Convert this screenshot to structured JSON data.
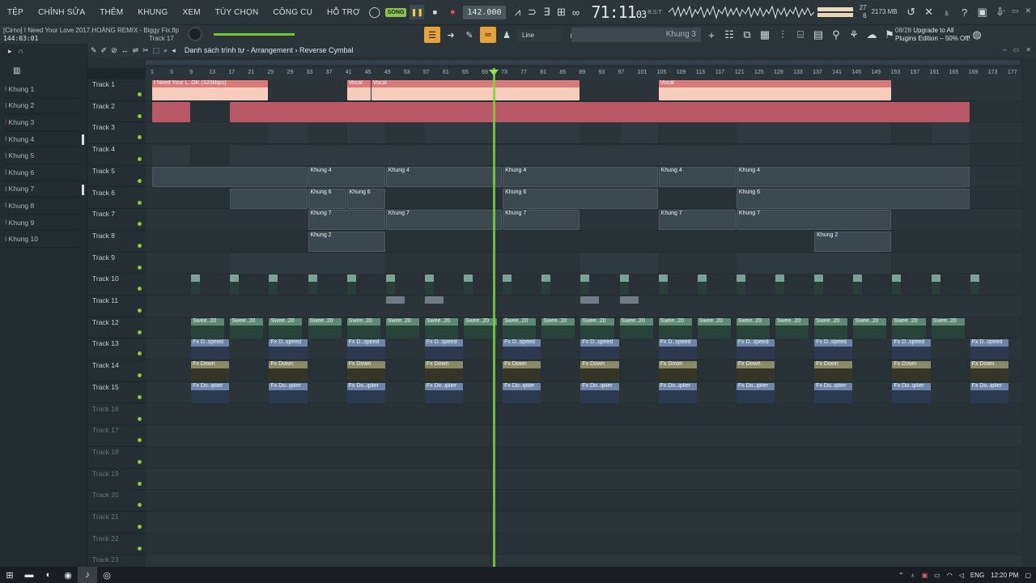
{
  "menu": [
    "TỆP",
    "CHỈNH SỬA",
    "THÊM",
    "KHUNG",
    "XEM",
    "TÙY CHỌN",
    "CÔNG CỤ",
    "HỖ TRỢ"
  ],
  "transport": {
    "song_label": "SONG",
    "tempo": "142.000",
    "clock": "71:11",
    "clock_ticks": "03",
    "clock_sub": "B:S:T"
  },
  "monitor": {
    "cpu_top": "27",
    "mem": "2173 MB",
    "poly": "6"
  },
  "file_title": "[Cirno] I Need Your Love 2017.HOÀNG REMIX - Biggy Fix.flp",
  "position": "144:03:01",
  "hint_track": "Track 17",
  "snap_label": "Line",
  "pattern_name": "Khung 3",
  "promo": {
    "line1": "08/28",
    "line1b": "Upgrade to All",
    "line2": "Plugins Edition – 50% Off!"
  },
  "channels": [
    {
      "label": "Khung 1",
      "active": false,
      "marked": false
    },
    {
      "label": "Khung 2",
      "active": false,
      "marked": false
    },
    {
      "label": "Khung 3",
      "active": true,
      "marked": false
    },
    {
      "label": "Khung 4",
      "active": false,
      "marked": true
    },
    {
      "label": "Khung 5",
      "active": false,
      "marked": false
    },
    {
      "label": "Khung 6",
      "active": false,
      "marked": false
    },
    {
      "label": "Khung 7",
      "active": false,
      "marked": true
    },
    {
      "label": "Khung 8",
      "active": false,
      "marked": false
    },
    {
      "label": "Khung 9",
      "active": false,
      "marked": false
    },
    {
      "label": "Khung 10",
      "active": false,
      "marked": false
    }
  ],
  "playlist": {
    "title": "Danh sách trình tự",
    "crumb1": "Arrangement",
    "crumb2": "Reverse Cymbal"
  },
  "ruler": [
    "1",
    "5",
    "9",
    "13",
    "17",
    "21",
    "25",
    "29",
    "33",
    "37",
    "41",
    "45",
    "49",
    "53",
    "57",
    "61",
    "65",
    "69",
    "73",
    "77",
    "81",
    "85",
    "89",
    "93",
    "97",
    "101",
    "105",
    "109",
    "113",
    "117",
    "121",
    "125",
    "129",
    "133",
    "137",
    "141",
    "145",
    "149",
    "153",
    "157",
    "161",
    "165",
    "169",
    "173",
    "177"
  ],
  "tracks": [
    {
      "label": "Track 1",
      "empty": false,
      "marked": true
    },
    {
      "label": "Track 2",
      "empty": false,
      "marked": false
    },
    {
      "label": "Track 3",
      "empty": false,
      "marked": true
    },
    {
      "label": "Track 4",
      "empty": false,
      "marked": false
    },
    {
      "label": "Track 5",
      "empty": false,
      "marked": true
    },
    {
      "label": "Track 6",
      "empty": false,
      "marked": false
    },
    {
      "label": "Track 7",
      "empty": false,
      "marked": true
    },
    {
      "label": "Track 8",
      "empty": false,
      "marked": false
    },
    {
      "label": "Track 9",
      "empty": false,
      "marked": false
    },
    {
      "label": "Track 10",
      "empty": false,
      "marked": false
    },
    {
      "label": "Track 11",
      "empty": false,
      "marked": false
    },
    {
      "label": "Track 12",
      "empty": false,
      "marked": true
    },
    {
      "label": "Track 13",
      "empty": false,
      "marked": false
    },
    {
      "label": "Track 14",
      "empty": false,
      "marked": false
    },
    {
      "label": "Track 15",
      "empty": false,
      "marked": false
    },
    {
      "label": "Track 16",
      "empty": true,
      "marked": false
    },
    {
      "label": "Track 17",
      "empty": true,
      "marked": false
    },
    {
      "label": "Track 18",
      "empty": true,
      "marked": false
    },
    {
      "label": "Track 19",
      "empty": true,
      "marked": false
    },
    {
      "label": "Track 20",
      "empty": true,
      "marked": false
    },
    {
      "label": "Track 21",
      "empty": true,
      "marked": false
    },
    {
      "label": "Track 22",
      "empty": true,
      "marked": false
    },
    {
      "label": "Track 23",
      "empty": true,
      "marked": false
    }
  ],
  "clips": [
    {
      "track": 0,
      "start": 1,
      "len": 24,
      "type": "audio-pink",
      "label": "I Need Your L..OK (320kbps)"
    },
    {
      "track": 0,
      "start": 41,
      "len": 5,
      "type": "audio-pink",
      "label": "Vocal"
    },
    {
      "track": 0,
      "start": 46,
      "len": 43,
      "type": "audio-pink",
      "label": "Vocal"
    },
    {
      "track": 0,
      "start": 105,
      "len": 48,
      "type": "audio-pink",
      "label": "Vocal"
    },
    {
      "track": 1,
      "start": 1,
      "len": 8,
      "type": "audio-red",
      "label": ""
    },
    {
      "track": 1,
      "start": 17,
      "len": 152,
      "type": "audio-red",
      "label": ""
    },
    {
      "track": 2,
      "start": 25,
      "len": 8,
      "type": "pattern-dark",
      "label": ""
    },
    {
      "track": 2,
      "start": 41,
      "len": 8,
      "type": "pattern-dark",
      "label": ""
    },
    {
      "track": 2,
      "start": 57,
      "len": 32,
      "type": "pattern-dark",
      "label": ""
    },
    {
      "track": 2,
      "start": 97,
      "len": 8,
      "type": "pattern-dark",
      "label": ""
    },
    {
      "track": 2,
      "start": 121,
      "len": 32,
      "type": "pattern-dark",
      "label": ""
    },
    {
      "track": 2,
      "start": 161,
      "len": 8,
      "type": "pattern-dark",
      "label": ""
    },
    {
      "track": 3,
      "start": 1,
      "len": 8,
      "type": "pattern-dark",
      "label": ""
    },
    {
      "track": 3,
      "start": 17,
      "len": 152,
      "type": "pattern-dark",
      "label": ""
    },
    {
      "track": 4,
      "start": 1,
      "len": 32,
      "type": "pattern-grey",
      "label": ""
    },
    {
      "track": 4,
      "start": 33,
      "len": 16,
      "type": "pattern-grey",
      "label": "Khung 4"
    },
    {
      "track": 4,
      "start": 49,
      "len": 24,
      "type": "pattern-grey",
      "label": "Khung 4"
    },
    {
      "track": 4,
      "start": 73,
      "len": 32,
      "type": "pattern-grey",
      "label": "Khung 4"
    },
    {
      "track": 4,
      "start": 105,
      "len": 16,
      "type": "pattern-grey",
      "label": "Khung 4"
    },
    {
      "track": 4,
      "start": 121,
      "len": 48,
      "type": "pattern-grey",
      "label": "Khung 4"
    },
    {
      "track": 5,
      "start": 17,
      "len": 16,
      "type": "pattern-grey",
      "label": ""
    },
    {
      "track": 5,
      "start": 33,
      "len": 8,
      "type": "pattern-grey",
      "label": "Khung 6"
    },
    {
      "track": 5,
      "start": 41,
      "len": 8,
      "type": "pattern-grey",
      "label": "Khung 6"
    },
    {
      "track": 5,
      "start": 73,
      "len": 32,
      "type": "pattern-grey",
      "label": "Khung 6"
    },
    {
      "track": 5,
      "start": 121,
      "len": 48,
      "type": "pattern-grey",
      "label": "Khung 6"
    },
    {
      "track": 6,
      "start": 33,
      "len": 16,
      "type": "pattern-grey",
      "label": "Khung 7"
    },
    {
      "track": 6,
      "start": 49,
      "len": 24,
      "type": "pattern-grey",
      "label": "Khung 7"
    },
    {
      "track": 6,
      "start": 73,
      "len": 16,
      "type": "pattern-grey",
      "label": "Khung 7"
    },
    {
      "track": 6,
      "start": 105,
      "len": 16,
      "type": "pattern-grey",
      "label": "Khung 7"
    },
    {
      "track": 6,
      "start": 121,
      "len": 32,
      "type": "pattern-grey",
      "label": "Khung 7"
    },
    {
      "track": 7,
      "start": 33,
      "len": 16,
      "type": "pattern-grey",
      "label": "Khung 2"
    },
    {
      "track": 7,
      "start": 137,
      "len": 16,
      "type": "pattern-grey",
      "label": "Khung 2"
    },
    {
      "track": 8,
      "start": 17,
      "len": 32,
      "type": "pattern-dark",
      "label": ""
    },
    {
      "track": 8,
      "start": 89,
      "len": 16,
      "type": "pattern-dark",
      "label": ""
    },
    {
      "track": 8,
      "start": 121,
      "len": 32,
      "type": "pattern-dark",
      "label": ""
    }
  ],
  "repeat_clips": [
    {
      "track": 9,
      "first": 9,
      "step": 8,
      "count": 21,
      "len": 2,
      "type": "marker",
      "label": ""
    },
    {
      "track": 10,
      "first": 49,
      "step": 8,
      "count": 2,
      "len": 4,
      "type": "auto-slate",
      "label": ""
    },
    {
      "track": 10,
      "first": 89,
      "step": 8,
      "count": 2,
      "len": 4,
      "type": "auto-slate",
      "label": ""
    },
    {
      "track": 11,
      "first": 9,
      "step": 8,
      "count": 20,
      "len": 7,
      "type": "auto-green",
      "label": "Swee..20"
    },
    {
      "track": 12,
      "first": 9,
      "step": 16,
      "count": 11,
      "len": 8,
      "type": "auto-blue",
      "label": "Fx D..speed"
    },
    {
      "track": 13,
      "first": 9,
      "step": 16,
      "count": 11,
      "len": 8,
      "type": "auto-olive",
      "label": "Fx Down"
    },
    {
      "track": 14,
      "first": 9,
      "step": 16,
      "count": 11,
      "len": 8,
      "type": "auto-blue",
      "label": "Fx Do..iplier"
    }
  ],
  "taskbar": {
    "lang": "ENG",
    "time": "12:20 PM"
  }
}
